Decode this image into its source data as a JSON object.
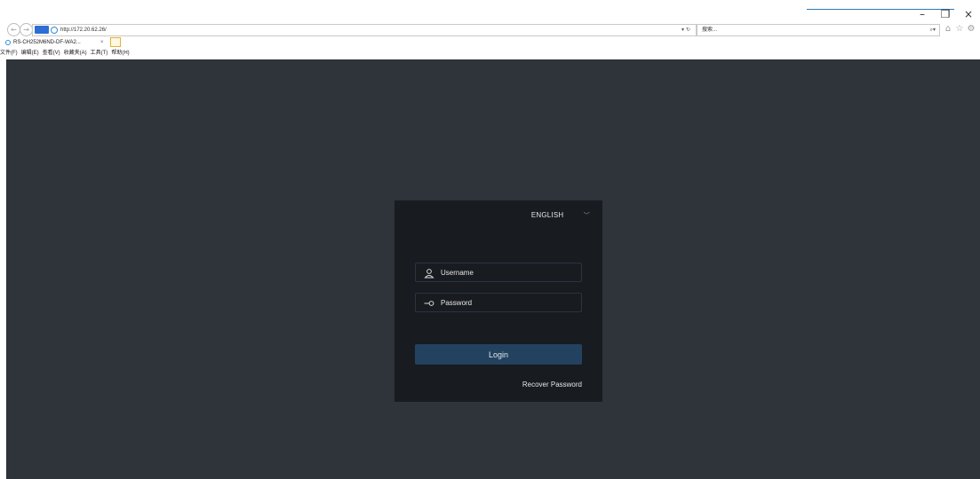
{
  "browser": {
    "address_url": "http://172.20.62.26/",
    "search_placeholder": "搜索...",
    "tab_title": "RS-CH252M6ND-DF-WA2...",
    "tab_close": "×",
    "window_controls": {
      "minimize": "–",
      "restore": "❐",
      "close": "×"
    },
    "menu": [
      "文件(F)",
      "编辑(E)",
      "查看(V)",
      "收藏夹(A)",
      "工具(T)",
      "帮助(H)"
    ]
  },
  "login": {
    "language": "ENGLISH",
    "username_placeholder": "Username",
    "password_placeholder": "Password",
    "login_label": "Login",
    "recover_label": "Recover Password"
  },
  "colors": {
    "page_bg": "#2f333a",
    "panel_bg": "#181b20",
    "button_bg": "#234260",
    "field_border": "#2b3442"
  }
}
